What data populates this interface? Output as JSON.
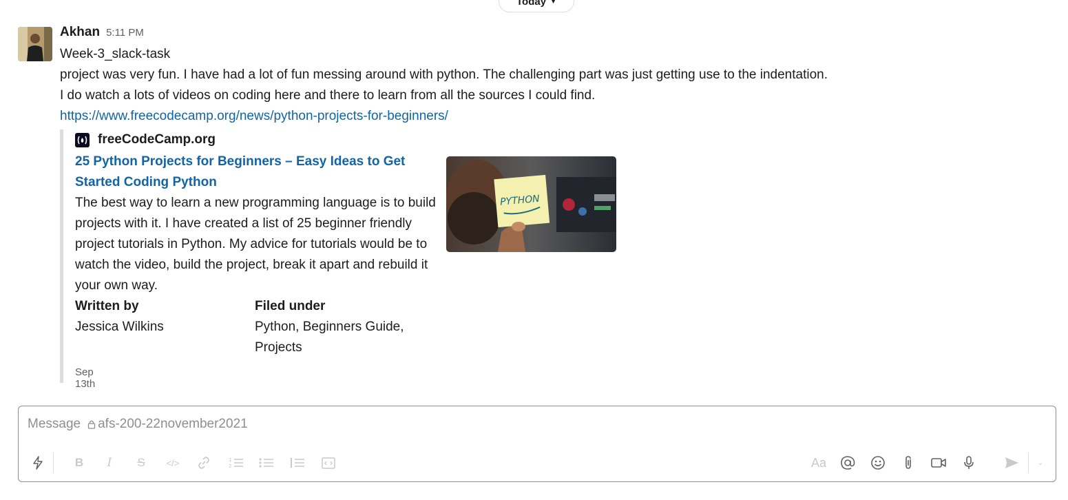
{
  "date_divider": {
    "label": "Today"
  },
  "message": {
    "author": "Akhan",
    "time": "5:11 PM",
    "lines": [
      "Week-3_slack-task",
      "project was very fun. I have had a lot of fun messing around with python. The challenging part was just getting use to the indentation.",
      "I do watch a lots of videos on coding here and there to learn from all the sources I could find."
    ],
    "link": "https://www.freecodecamp.org/news/python-projects-for-beginners/"
  },
  "unfurl": {
    "site_name": "freeCodeCamp.org",
    "site_icon_text": "(⋀)",
    "title": "25 Python Projects for Beginners – Easy Ideas to Get Started Coding Python",
    "description": "The best way to learn a new programming language is to build projects with it. I have created a list of 25 beginner friendly project tutorials in Python. My advice for tutorials would be to watch the video, build the project, break it apart and rebuild it your own way.",
    "fields": [
      {
        "label": "Written by",
        "value": "Jessica Wilkins"
      },
      {
        "label": "Filed under",
        "value": "Python, Beginners Guide, Projects"
      }
    ],
    "date": "Sep 13th",
    "thumb_text": "PYTHON"
  },
  "composer": {
    "placeholder_prefix": "Message",
    "channel": "afs-200-22november2021",
    "format_text_label": "Aa"
  },
  "colors": {
    "link": "#1264a3",
    "border": "#dddddd",
    "muted": "#616061"
  }
}
